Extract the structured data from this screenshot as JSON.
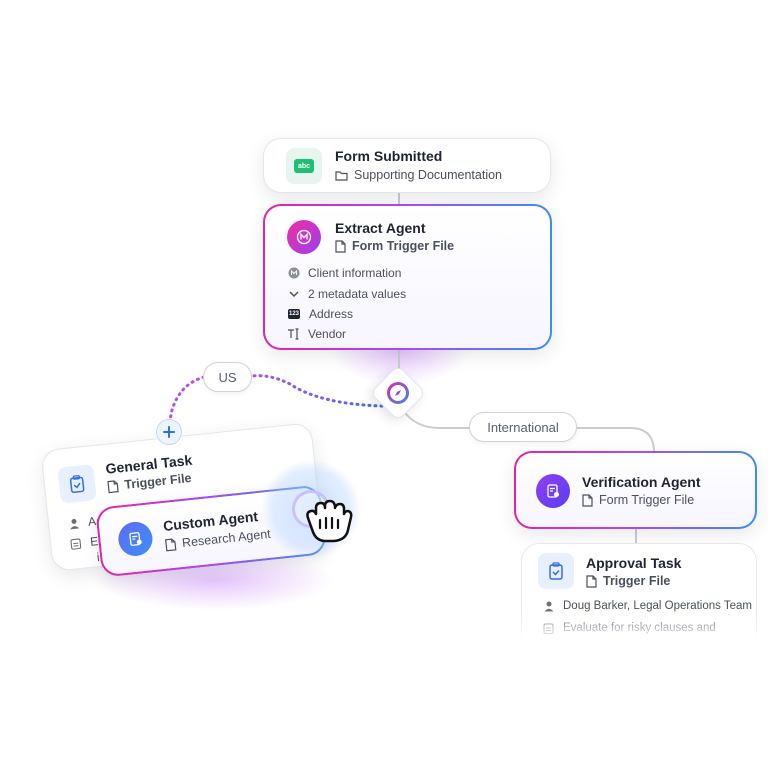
{
  "form_card": {
    "title": "Form Submitted",
    "subtitle": "Supporting Documentation",
    "icon_text": "abc"
  },
  "extract_card": {
    "title": "Extract Agent",
    "subtitle": "Form Trigger File",
    "fields": [
      "Client information",
      "2 metadata values",
      "Address",
      "Vendor"
    ],
    "number_badge": "123"
  },
  "branches": {
    "left": "US",
    "right": "International"
  },
  "general_task": {
    "title": "General Task",
    "subtitle": "Trigger File",
    "line1": "Aa",
    "line2": "E",
    "line3": "i"
  },
  "custom_agent": {
    "title": "Custom Agent",
    "subtitle": "Research Agent"
  },
  "verification_card": {
    "title": "Verification Agent",
    "subtitle": "Form Trigger File"
  },
  "approval_card": {
    "title": "Approval Task",
    "subtitle": "Trigger File",
    "assignee": "Doug Barker, Legal Operations Team",
    "instruction": "Evaluate for risky clauses and"
  },
  "colors": {
    "accent_pink": "#e024a4",
    "accent_purple": "#a84cf0",
    "accent_blue": "#3a8ef0",
    "connector": "#c9ccd4",
    "green_tile": "#1fbf74"
  }
}
